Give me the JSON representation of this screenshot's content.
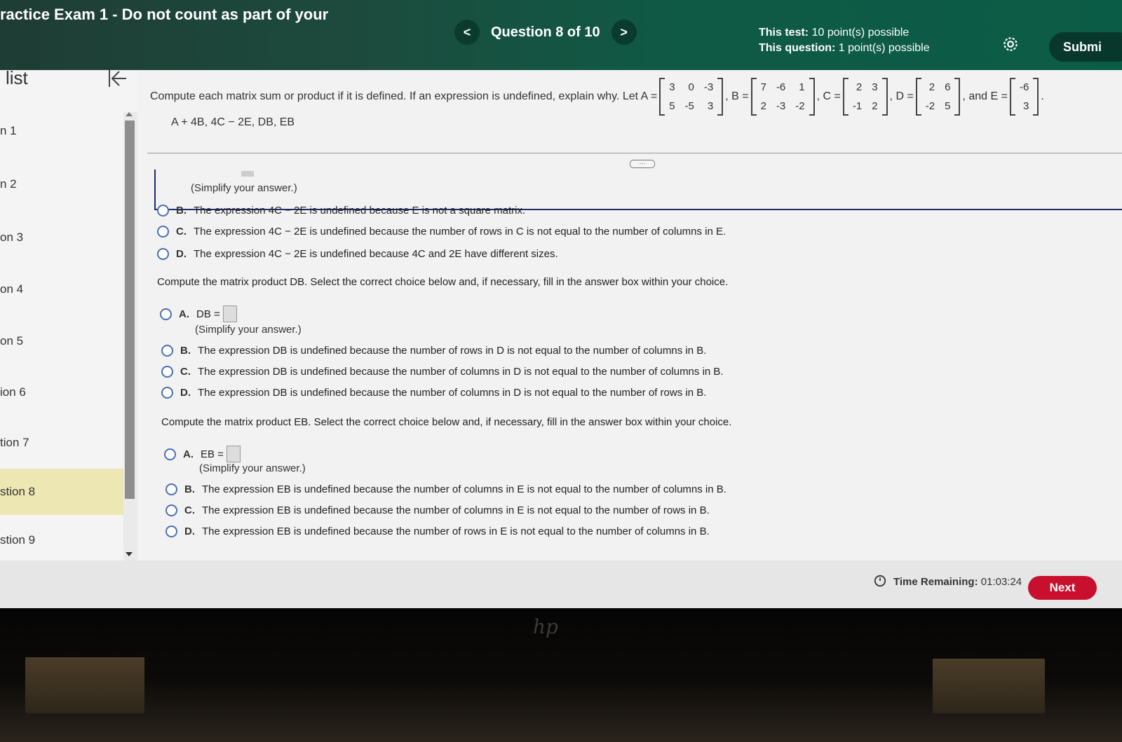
{
  "header": {
    "exam_title": "ractice Exam 1 - Do not count as part of your",
    "question_label": "Question 8 of 10",
    "prev_glyph": "<",
    "next_glyph": ">",
    "test_points_label": "This test:",
    "test_points_value": "10 point(s) possible",
    "question_points_label": "This question:",
    "question_points_value": "1 point(s) possible",
    "submit_label": "Submi"
  },
  "sidebar": {
    "title": "list",
    "items": [
      {
        "label": "n 1"
      },
      {
        "label": "n 2"
      },
      {
        "label": "on 3"
      },
      {
        "label": "on 4"
      },
      {
        "label": "on 5"
      },
      {
        "label": "ion 6"
      },
      {
        "label": "tion 7"
      },
      {
        "label": "stion 8",
        "active": true
      },
      {
        "label": "stion 9"
      }
    ]
  },
  "problem": {
    "prompt": "Compute each matrix sum or product if it is defined. If an expression is undefined, explain why. Let A =",
    "matrices": {
      "A": [
        [
          "3",
          "0",
          "-3"
        ],
        [
          "5",
          "-5",
          "3"
        ]
      ],
      "B_label": ", B =",
      "B": [
        [
          "7",
          "-6",
          "1"
        ],
        [
          "2",
          "-3",
          "-2"
        ]
      ],
      "C_label": ", C =",
      "C": [
        [
          "2",
          "3"
        ],
        [
          "-1",
          "2"
        ]
      ],
      "D_label": ", D =",
      "D": [
        [
          "2",
          "6"
        ],
        [
          "-2",
          "5"
        ]
      ],
      "E_label": ", and E =",
      "E": [
        [
          "-6"
        ],
        [
          "3"
        ]
      ],
      "end": "."
    },
    "expressions": "A + 4B, 4C − 2E, DB, EB"
  },
  "part_4c2e": {
    "simplify_note": "(Simplify your answer.)",
    "options": [
      {
        "letter": "B.",
        "text": "The expression 4C − 2E is undefined because E is not a square matrix."
      },
      {
        "letter": "C.",
        "text": "The expression 4C − 2E is undefined because the number of rows in C is not equal to the number of columns in E."
      },
      {
        "letter": "D.",
        "text": "The expression 4C − 2E is undefined because 4C and 2E have different sizes."
      }
    ]
  },
  "part_db": {
    "question": "Compute the matrix product DB. Select the correct choice below and, if necessary, fill in the answer box within your choice.",
    "option_a_letter": "A.",
    "option_a_text": "DB =",
    "simplify_note": "(Simplify your answer.)",
    "options": [
      {
        "letter": "B.",
        "text": "The expression DB is undefined because the number of rows in D is not equal to the number of columns in B."
      },
      {
        "letter": "C.",
        "text": "The expression DB is undefined because the number of columns in D is not equal to the number of columns in B."
      },
      {
        "letter": "D.",
        "text": "The expression DB is undefined because the number of columns in D is not equal to the number of rows in B."
      }
    ]
  },
  "part_eb": {
    "question": "Compute the matrix product EB. Select the correct choice below and, if necessary, fill in the answer box within your choice.",
    "option_a_letter": "A.",
    "option_a_text": "EB =",
    "simplify_note": "(Simplify your answer.)",
    "options": [
      {
        "letter": "B.",
        "text": "The expression EB is undefined because the number of columns in E is not equal to the number of columns in B."
      },
      {
        "letter": "C.",
        "text": "The expression EB is undefined because the number of columns in E is not equal to the number of rows in B."
      },
      {
        "letter": "D.",
        "text": "The expression EB is undefined because the number of rows in E is not equal to the number of columns in B."
      }
    ]
  },
  "footer": {
    "timer_label": "Time Remaining:",
    "timer_value": "01:03:24",
    "next_label": "Next"
  },
  "bezel": {
    "logo": "hp"
  },
  "colors": {
    "header_green": "#0b5c46",
    "next_red": "#c8102e",
    "active_item": "#ede7b3",
    "radio_blue": "#4a6fb0"
  }
}
